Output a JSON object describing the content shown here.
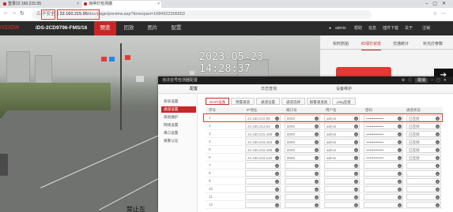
{
  "browser": {
    "tabs": [
      {
        "label": "登录22.160.215.95"
      },
      {
        "label": "违停灯检测摄"
      }
    ],
    "url_prefix": "不安全",
    "url_host": "22.160.215.95",
    "url_path": "/doc/page/preview.asp?timespan=1684922306653"
  },
  "app": {
    "brand": "HIKVISION",
    "model": "iDS-2CD9796-FMS/16",
    "menu": [
      {
        "label": "预览"
      },
      {
        "label": "回放"
      },
      {
        "label": "图片"
      },
      {
        "label": "配置"
      }
    ],
    "user": "admin",
    "header_links": [
      {
        "label": "帮助"
      },
      {
        "label": "信息"
      },
      {
        "label": "插件下载"
      },
      {
        "label": "关于"
      },
      {
        "label": "注销"
      }
    ]
  },
  "video": {
    "osd_time": "2023-05-23  14:28:37",
    "bottom_caption": "禁止左"
  },
  "side_panel": {
    "tabs": [
      {
        "label": "实时抓拍"
      },
      {
        "label": "红绿灯状态"
      },
      {
        "label": "交通统计"
      },
      {
        "label": "补光灯参数"
      }
    ],
    "arrow": "➔"
  },
  "dialog": {
    "title": "违法信号检测器配置",
    "cancel_label": "取消",
    "tabs": [
      {
        "label": "配置"
      },
      {
        "label": "日志查询"
      },
      {
        "label": "设备维护"
      }
    ],
    "sidebar": [
      {
        "label": "系统设置"
      },
      {
        "label": "通道设置"
      },
      {
        "label": "系统维护"
      },
      {
        "label": "网络设置"
      },
      {
        "label": "串口设置"
      },
      {
        "label": "报警认证"
      }
    ],
    "subtabs": [
      {
        "label": "ISAPI设备"
      },
      {
        "label": "预置通道"
      },
      {
        "label": "通道设置"
      },
      {
        "label": "通道选择"
      },
      {
        "label": "报警通道类"
      },
      {
        "label": "ping连接"
      }
    ],
    "columns": [
      "序号",
      "IP地址",
      "端口号",
      "用户名",
      "密码",
      "通道状态"
    ],
    "rows": [
      {
        "idx": "1",
        "ip": "22.160.215.95",
        "port": "8000",
        "user": "admin",
        "pwd": "••••••••••••••",
        "status": "已连接"
      },
      {
        "idx": "2",
        "ip": "22.160.213.94",
        "port": "8000",
        "user": "admin",
        "pwd": "••••••••••••••",
        "status": "已连接"
      },
      {
        "idx": "3",
        "ip": "22.160.215.180",
        "port": "8000",
        "user": "admin",
        "pwd": "••••••••••••••",
        "status": "已连接"
      },
      {
        "idx": "4",
        "ip": "22.160.215.183",
        "port": "8000",
        "user": "admin",
        "pwd": "••••••••••••••",
        "status": "已连接"
      },
      {
        "idx": "5",
        "ip": "22.160.215.185",
        "port": "8000",
        "user": "admin",
        "pwd": "••••••••••••••",
        "status": "已连接"
      },
      {
        "idx": "6",
        "ip": "22.160.215.110",
        "port": "8000",
        "user": "admin",
        "pwd": "••••••••••••••",
        "status": "已连接"
      },
      {
        "idx": "7",
        "ip": "",
        "port": "",
        "user": "",
        "pwd": "",
        "status": ""
      },
      {
        "idx": "8",
        "ip": "",
        "port": "",
        "user": "",
        "pwd": "",
        "status": ""
      },
      {
        "idx": "9",
        "ip": "",
        "port": "",
        "user": "",
        "pwd": "",
        "status": ""
      },
      {
        "idx": "10",
        "ip": "",
        "port": "",
        "user": "",
        "pwd": "",
        "status": ""
      },
      {
        "idx": "11",
        "ip": "",
        "port": "",
        "user": "",
        "pwd": "",
        "status": ""
      },
      {
        "idx": "12",
        "ip": "",
        "port": "",
        "user": "",
        "pwd": "",
        "status": ""
      }
    ]
  },
  "colors": {
    "accent": "#c62828",
    "header_bg": "#2b2b2b",
    "highlight": "#e53935"
  },
  "icons": [
    "lock-icon",
    "refresh-icon",
    "back-icon",
    "close-icon",
    "user-icon",
    "arrow-right-icon"
  ]
}
